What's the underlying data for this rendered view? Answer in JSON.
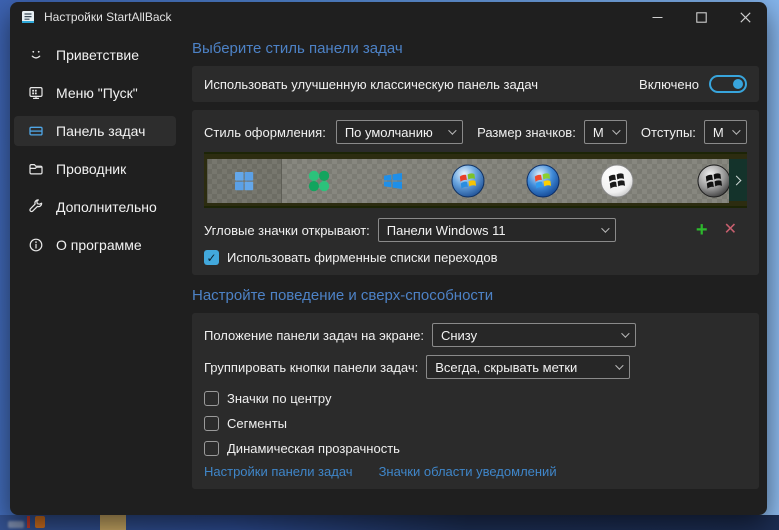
{
  "window": {
    "title": "Настройки StartAllBack"
  },
  "sidebar": {
    "items": [
      {
        "label": "Приветствие"
      },
      {
        "label": "Меню \"Пуск\""
      },
      {
        "label": "Панель задач"
      },
      {
        "label": "Проводник"
      },
      {
        "label": "Дополнительно"
      },
      {
        "label": "О программе"
      }
    ]
  },
  "taskbar_section": {
    "header": "Выберите стиль панели задач",
    "classic_toggle": {
      "label": "Использовать улучшенную классическую панель задач",
      "state": "Включено",
      "enabled": true
    },
    "visual_style": {
      "label": "Стиль оформления:",
      "value": "По умолчанию"
    },
    "icon_size": {
      "label": "Размер значков:",
      "value": "M"
    },
    "margins": {
      "label": "Отступы:",
      "value": "M"
    },
    "preview_styles": [
      "windows-11",
      "startallback-clover",
      "windows-10",
      "windows-7-orb",
      "windows-vista-orb",
      "classic-light-orb",
      "classic-dark-orb"
    ],
    "corner_icons": {
      "label": "Угловые значки открывают:",
      "value": "Панели Windows 11",
      "add": "+",
      "remove": "✕"
    },
    "jump_lists": {
      "label": "Использовать фирменные списки переходов",
      "checked": true
    }
  },
  "behavior_section": {
    "header": "Настройте поведение и сверх-способности",
    "position": {
      "label": "Положение панели задач на экране:",
      "value": "Снизу"
    },
    "grouping": {
      "label": "Группировать кнопки панели задач:",
      "value": "Всегда, скрывать метки"
    },
    "checkboxes": [
      {
        "label": "Значки по центру",
        "checked": false
      },
      {
        "label": "Сегменты",
        "checked": false
      },
      {
        "label": "Динамическая прозрачность",
        "checked": false
      }
    ],
    "links": [
      {
        "label": "Настройки панели задач"
      },
      {
        "label": "Значки области уведомлений"
      }
    ]
  },
  "icons": {
    "check": "✓"
  },
  "colors": {
    "accent_toggle": "#38a5dc",
    "header_blue": "#4d82c6",
    "link_blue": "#3f86c9",
    "add_green": "#2db92d",
    "remove_red": "#c75f6e",
    "window_bg": "#1f1f1f",
    "card_bg": "#2b2b2b"
  }
}
